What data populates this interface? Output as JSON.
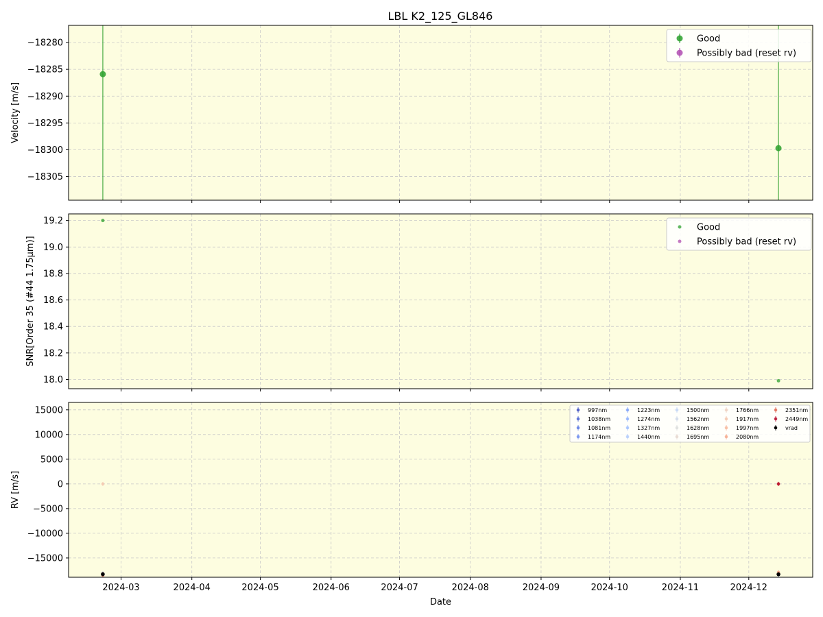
{
  "figure": {
    "title": "LBL K2_125_GL846",
    "background": "#ffffff",
    "panel_background": "#fdfde0",
    "grid_color": "#c8c8c8"
  },
  "chart_data": [
    {
      "type": "scatter",
      "ylabel": "Velocity [m/s]",
      "xlabel": "",
      "xlim": [
        "2024-02-07",
        "2024-12-29"
      ],
      "ylim": [
        -18309.4,
        -18276.8
      ],
      "yticks": [
        -18280,
        -18285,
        -18290,
        -18295,
        -18300,
        -18305
      ],
      "yticks_labels": [
        "−18280",
        "−18285",
        "−18290",
        "−18295",
        "−18300",
        "−18305"
      ],
      "grid": true,
      "legend_position": "top-right",
      "legend": [
        {
          "label": "Good",
          "color": "#2ca02c"
        },
        {
          "label": "Possibly bad (reset rv)",
          "color": "#b04cb0"
        }
      ],
      "series": [
        {
          "name": "Good",
          "color": "#2ca02c",
          "errorbars": true,
          "points": [
            {
              "x": "2024-02-22",
              "y": -18285.9,
              "yerr": 200
            },
            {
              "x": "2024-12-14",
              "y": -18299.7,
              "yerr": 200
            }
          ]
        },
        {
          "name": "Possibly bad (reset rv)",
          "color": "#b04cb0",
          "errorbars": true,
          "points": []
        }
      ]
    },
    {
      "type": "scatter",
      "ylabel": "SNR[Order 35 (#44 1.75μm)]",
      "xlabel": "",
      "xlim": [
        "2024-02-07",
        "2024-12-29"
      ],
      "ylim": [
        17.93,
        19.25
      ],
      "yticks": [
        19.2,
        19.0,
        18.8,
        18.6,
        18.4,
        18.2,
        18.0
      ],
      "yticks_labels": [
        "19.2",
        "19.0",
        "18.8",
        "18.6",
        "18.4",
        "18.2",
        "18.0"
      ],
      "grid": true,
      "legend_position": "top-right",
      "legend": [
        {
          "label": "Good",
          "color": "#2ca02c"
        },
        {
          "label": "Possibly bad (reset rv)",
          "color": "#b04cb0"
        }
      ],
      "series": [
        {
          "name": "Good",
          "color": "#2ca02c",
          "errorbars": false,
          "points": [
            {
              "x": "2024-02-22",
              "y": 19.2
            },
            {
              "x": "2024-12-14",
              "y": 17.99
            }
          ]
        },
        {
          "name": "Possibly bad (reset rv)",
          "color": "#b04cb0",
          "errorbars": false,
          "points": []
        }
      ]
    },
    {
      "type": "scatter",
      "ylabel": "RV [m/s]",
      "xlabel": "Date",
      "xlim": [
        "2024-02-07",
        "2024-12-29"
      ],
      "ylim": [
        -18900,
        16500
      ],
      "yticks": [
        15000,
        10000,
        5000,
        0,
        -5000,
        -10000,
        -15000
      ],
      "yticks_labels": [
        "15000",
        "10000",
        "5000",
        "0",
        "−5000",
        "−10000",
        "−15000"
      ],
      "xticks": [
        "2024-03-01",
        "2024-04-01",
        "2024-05-01",
        "2024-06-01",
        "2024-07-01",
        "2024-08-01",
        "2024-09-01",
        "2024-10-01",
        "2024-11-01",
        "2024-12-01"
      ],
      "xticks_labels": [
        "2024-03",
        "2024-04",
        "2024-05",
        "2024-06",
        "2024-07",
        "2024-08",
        "2024-09",
        "2024-10",
        "2024-11",
        "2024-12"
      ],
      "grid": true,
      "legend_position": "top-right",
      "legend_columns": 5,
      "series": [
        {
          "name": "997nm",
          "color": "#3b4cc0",
          "values": [
            -18400,
            -18250
          ]
        },
        {
          "name": "1038nm",
          "color": "#4961d2",
          "values": [
            -18350,
            -18200
          ]
        },
        {
          "name": "1081nm",
          "color": "#5977e3",
          "values": [
            -18300,
            -18350
          ]
        },
        {
          "name": "1174nm",
          "color": "#6a8bef",
          "values": [
            -18250,
            -18300
          ]
        },
        {
          "name": "1223nm",
          "color": "#7b9ff9",
          "values": [
            -18200,
            -18400
          ]
        },
        {
          "name": "1274nm",
          "color": "#8db0fe",
          "values": [
            -18150,
            -18250
          ]
        },
        {
          "name": "1327nm",
          "color": "#9ebeff",
          "values": [
            -18300,
            -18200
          ]
        },
        {
          "name": "1440nm",
          "color": "#b0cbfc",
          "values": [
            -18250,
            -18350
          ]
        },
        {
          "name": "1500nm",
          "color": "#c0d4f5",
          "values": [
            -18200,
            -18300
          ]
        },
        {
          "name": "1562nm",
          "color": "#cfdaea",
          "values": [
            -18350,
            -18250
          ]
        },
        {
          "name": "1628nm",
          "color": "#dcdddd",
          "values": [
            -18300,
            -18200
          ]
        },
        {
          "name": "1695nm",
          "color": "#e6d7cf",
          "values": [
            -18250,
            -18300
          ]
        },
        {
          "name": "1766nm",
          "color": "#eecfbf",
          "values": [
            -18200,
            -18150
          ]
        },
        {
          "name": "1917nm",
          "color": "#f4c5ad",
          "values": [
            -10,
            -18250
          ]
        },
        {
          "name": "1997nm",
          "color": "#f6b79b",
          "values": [
            -18600,
            -18000
          ]
        },
        {
          "name": "2080nm",
          "color": "#f5a889",
          "values": [
            -18500,
            -17900
          ]
        },
        {
          "name": "2351nm",
          "color": "#e0654f",
          "values": [
            -18300,
            -30
          ]
        },
        {
          "name": "2449nm",
          "color": "#b40426",
          "values": [
            -18250,
            10
          ]
        },
        {
          "name": "vrad",
          "color": "#000000",
          "values": [
            -18286,
            -18300
          ]
        }
      ],
      "x": [
        "2024-02-22",
        "2024-12-14"
      ]
    }
  ]
}
